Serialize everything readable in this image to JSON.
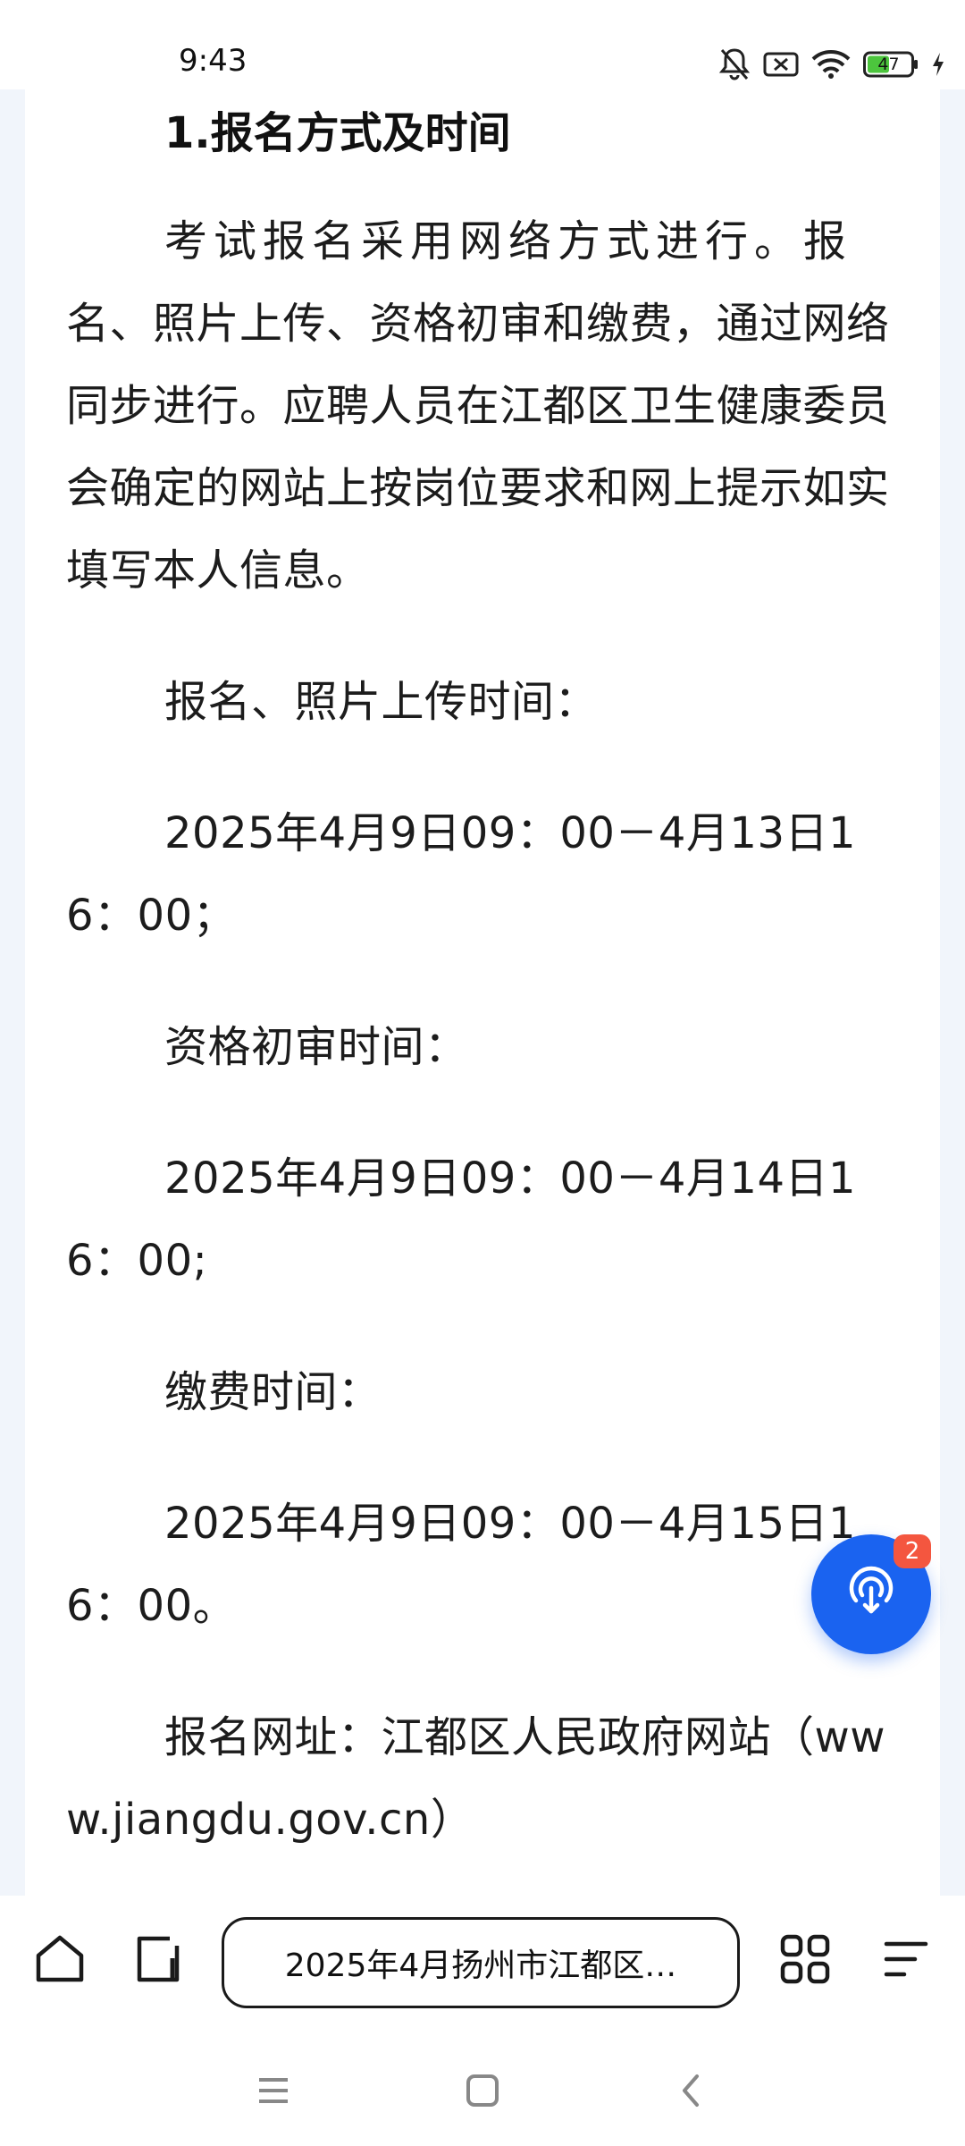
{
  "status_bar": {
    "time": "9:43",
    "battery_level": "47",
    "icons": [
      "bell-muted-icon",
      "sim-blocked-icon",
      "wifi-icon",
      "battery-icon",
      "charging-icon"
    ]
  },
  "article": {
    "heading": "1.报名方式及时间",
    "intro_start": "考试报名采用网络方式进行。报",
    "intro_rest": "名、照片上传、资格初审和缴费，通过网络同步进行。应聘人员在江都区卫生健康委员会确定的网站上按岗位要求和网上提示如实填写本人信息。",
    "upload_label": "报名、照片上传时间：",
    "upload_time": "2025年4月9日09：00－4月13日16：00；",
    "review_label": "资格初审时间：",
    "review_time": "2025年4月9日09：00－4月14日16：00;",
    "payment_label": "缴费时间：",
    "payment_time": "2025年4月9日09：00－4月15日16：00。",
    "website_line": "报名网址：江都区人民政府网站（www.jiangdu.gov.cn）"
  },
  "fab": {
    "icon": "podcast-download-icon",
    "badge": "2",
    "color": "#1a63f0"
  },
  "toolbar": {
    "address_title": "2025年4月扬州市江都区…",
    "home_icon": "home-icon",
    "tabs_icon": "tab-switch-icon",
    "grid_icon": "grid-menu-icon",
    "menu_icon": "hamburger-menu-icon"
  },
  "navbar": {
    "icons": [
      "nav-menu-icon",
      "nav-home-icon",
      "nav-back-icon"
    ]
  }
}
